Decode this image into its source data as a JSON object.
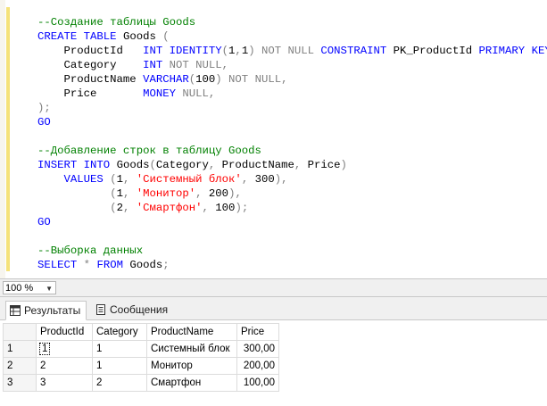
{
  "editor": {
    "lines": [
      [
        {
          "t": "--Создание таблицы Goods",
          "c": "cm"
        }
      ],
      [
        {
          "t": "CREATE TABLE",
          "c": "kw"
        },
        {
          "t": " Goods ",
          "c": ""
        },
        {
          "t": "(",
          "c": "op"
        }
      ],
      [
        {
          "t": "    ProductId   ",
          "c": ""
        },
        {
          "t": "INT IDENTITY",
          "c": "kw"
        },
        {
          "t": "(",
          "c": "op"
        },
        {
          "t": "1",
          "c": ""
        },
        {
          "t": ",",
          "c": "op"
        },
        {
          "t": "1",
          "c": ""
        },
        {
          "t": ")",
          "c": "op"
        },
        {
          "t": " ",
          "c": ""
        },
        {
          "t": "NOT NULL",
          "c": "op"
        },
        {
          "t": " ",
          "c": ""
        },
        {
          "t": "CONSTRAINT",
          "c": "kw"
        },
        {
          "t": " PK_ProductId ",
          "c": ""
        },
        {
          "t": "PRIMARY KEY",
          "c": "kw"
        },
        {
          "t": ",",
          "c": "op"
        }
      ],
      [
        {
          "t": "    Category    ",
          "c": ""
        },
        {
          "t": "INT",
          "c": "kw"
        },
        {
          "t": " ",
          "c": ""
        },
        {
          "t": "NOT NULL,",
          "c": "op"
        }
      ],
      [
        {
          "t": "    ProductName ",
          "c": ""
        },
        {
          "t": "VARCHAR",
          "c": "kw"
        },
        {
          "t": "(",
          "c": "op"
        },
        {
          "t": "100",
          "c": ""
        },
        {
          "t": ")",
          "c": "op"
        },
        {
          "t": " ",
          "c": ""
        },
        {
          "t": "NOT NULL,",
          "c": "op"
        }
      ],
      [
        {
          "t": "    Price       ",
          "c": ""
        },
        {
          "t": "MONEY",
          "c": "kw"
        },
        {
          "t": " ",
          "c": ""
        },
        {
          "t": "NULL,",
          "c": "op"
        }
      ],
      [
        {
          "t": ");",
          "c": "op"
        }
      ],
      [
        {
          "t": "GO",
          "c": "kw"
        }
      ],
      [
        {
          "t": "",
          "c": ""
        }
      ],
      [
        {
          "t": "--Добавление строк в таблицу Goods",
          "c": "cm"
        }
      ],
      [
        {
          "t": "INSERT INTO",
          "c": "kw"
        },
        {
          "t": " Goods",
          "c": ""
        },
        {
          "t": "(",
          "c": "op"
        },
        {
          "t": "Category",
          "c": ""
        },
        {
          "t": ",",
          "c": "op"
        },
        {
          "t": " ProductName",
          "c": ""
        },
        {
          "t": ",",
          "c": "op"
        },
        {
          "t": " Price",
          "c": ""
        },
        {
          "t": ")",
          "c": "op"
        }
      ],
      [
        {
          "t": "    VALUES",
          "c": "kw"
        },
        {
          "t": " ",
          "c": ""
        },
        {
          "t": "(",
          "c": "op"
        },
        {
          "t": "1",
          "c": ""
        },
        {
          "t": ", ",
          "c": "op"
        },
        {
          "t": "'Системный блок'",
          "c": "str"
        },
        {
          "t": ", ",
          "c": "op"
        },
        {
          "t": "300",
          "c": ""
        },
        {
          "t": "),",
          "c": "op"
        }
      ],
      [
        {
          "t": "           ",
          "c": ""
        },
        {
          "t": "(",
          "c": "op"
        },
        {
          "t": "1",
          "c": ""
        },
        {
          "t": ", ",
          "c": "op"
        },
        {
          "t": "'Монитор'",
          "c": "str"
        },
        {
          "t": ", ",
          "c": "op"
        },
        {
          "t": "200",
          "c": ""
        },
        {
          "t": "),",
          "c": "op"
        }
      ],
      [
        {
          "t": "           ",
          "c": ""
        },
        {
          "t": "(",
          "c": "op"
        },
        {
          "t": "2",
          "c": ""
        },
        {
          "t": ", ",
          "c": "op"
        },
        {
          "t": "'Смартфон'",
          "c": "str"
        },
        {
          "t": ", ",
          "c": "op"
        },
        {
          "t": "100",
          "c": ""
        },
        {
          "t": ");",
          "c": "op"
        }
      ],
      [
        {
          "t": "GO",
          "c": "kw"
        }
      ],
      [
        {
          "t": "",
          "c": ""
        }
      ],
      [
        {
          "t": "--Выборка данных",
          "c": "cm"
        }
      ],
      [
        {
          "t": "SELECT",
          "c": "kw"
        },
        {
          "t": " ",
          "c": ""
        },
        {
          "t": "*",
          "c": "op"
        },
        {
          "t": " ",
          "c": ""
        },
        {
          "t": "FROM",
          "c": "kw"
        },
        {
          "t": " Goods",
          "c": ""
        },
        {
          "t": ";",
          "c": "op"
        }
      ]
    ]
  },
  "zoom": {
    "value": "100 %"
  },
  "tabs": {
    "results": "Результаты",
    "messages": "Сообщения"
  },
  "grid": {
    "columns": [
      "ProductId",
      "Category",
      "ProductName",
      "Price"
    ],
    "rows": [
      {
        "n": "1",
        "cells": [
          "1",
          "1",
          "Системный блок",
          "300,00"
        ]
      },
      {
        "n": "2",
        "cells": [
          "2",
          "1",
          "Монитор",
          "200,00"
        ]
      },
      {
        "n": "3",
        "cells": [
          "3",
          "2",
          "Смартфон",
          "100,00"
        ]
      }
    ]
  },
  "colors": {
    "keyword": "#0000ff",
    "function": "#ff00ff",
    "operator": "#808080",
    "string": "#ff0000",
    "comment": "#008000"
  }
}
